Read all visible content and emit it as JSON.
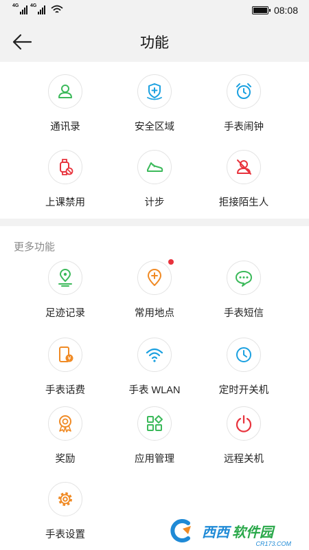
{
  "status_bar": {
    "signal_tag_1": "4G",
    "signal_tag_2": "4G",
    "time": "08:08",
    "icons": [
      "signal-icon",
      "signal-icon",
      "wifi-icon",
      "battery-icon"
    ]
  },
  "header": {
    "title": "功能",
    "back_icon": "back-arrow-icon"
  },
  "main_features": [
    {
      "label": "通讯录",
      "icon": "contacts-icon",
      "color": "#3bb95a"
    },
    {
      "label": "安全区域",
      "icon": "safe-zone-icon",
      "color": "#1aa0e0"
    },
    {
      "label": "手表闹钟",
      "icon": "alarm-icon",
      "color": "#1aa0e0"
    },
    {
      "label": "上课禁用",
      "icon": "class-disable-icon",
      "color": "#e8323c"
    },
    {
      "label": "计步",
      "icon": "step-counter-icon",
      "color": "#3bb95a"
    },
    {
      "label": "拒接陌生人",
      "icon": "reject-stranger-icon",
      "color": "#e8323c"
    }
  ],
  "more_section": {
    "title": "更多功能",
    "items": [
      {
        "label": "足迹记录",
        "icon": "footprint-icon",
        "color": "#3bb95a",
        "badge": false
      },
      {
        "label": "常用地点",
        "icon": "favorite-place-icon",
        "color": "#f08a24",
        "badge": true
      },
      {
        "label": "手表短信",
        "icon": "message-icon",
        "color": "#3bb95a",
        "badge": false
      },
      {
        "label": "手表话费",
        "icon": "phone-fee-icon",
        "color": "#f08a24",
        "badge": false
      },
      {
        "label": "手表 WLAN",
        "icon": "wlan-icon",
        "color": "#1aa0e0",
        "badge": false
      },
      {
        "label": "定时开关机",
        "icon": "timer-power-icon",
        "color": "#1aa0e0",
        "badge": false
      },
      {
        "label": "奖励",
        "icon": "reward-icon",
        "color": "#f08a24",
        "badge": false
      },
      {
        "label": "应用管理",
        "icon": "app-manage-icon",
        "color": "#3bb95a",
        "badge": false
      },
      {
        "label": "远程关机",
        "icon": "remote-shutdown-icon",
        "color": "#e8323c",
        "badge": false
      },
      {
        "label": "手表设置",
        "icon": "settings-icon",
        "color": "#f08a24",
        "badge": false
      }
    ]
  },
  "watermark": {
    "brand": "西西",
    "text": "软件园",
    "sub": "CR173.COM"
  }
}
